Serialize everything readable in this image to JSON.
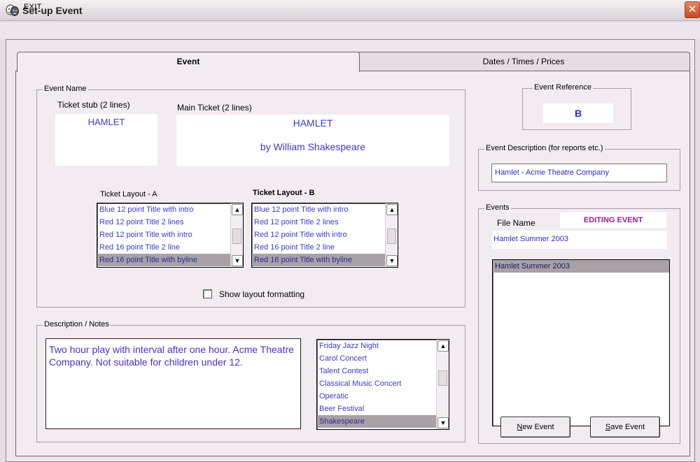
{
  "window": {
    "title": "Set-up Event",
    "close_symbol": "✕"
  },
  "menu": {
    "exit_label": "EXIT"
  },
  "tabs": [
    {
      "label": "Event",
      "active": true
    },
    {
      "label": "Dates / Times / Prices",
      "active": false
    }
  ],
  "event_name": {
    "group_label": "Event Name",
    "ticket_stub_label": "Ticket stub (2 lines)",
    "ticket_stub_text": "HAMLET",
    "main_ticket_label": "Main Ticket (2 lines)",
    "main_ticket_line1": "HAMLET",
    "main_ticket_line2": "by William Shakespeare",
    "layout_a_label": "Ticket Layout -  A",
    "layout_b_label": "Ticket Layout -  B",
    "layout_options": [
      "Blue 12 point Title with intro",
      "Red 12 point Title 2 lines",
      "Red 12 point Title with intro",
      "Red 16 point Title 2 line",
      "Red 16 point Title with byline"
    ],
    "layout_a_selected_index": 4,
    "layout_b_selected_index": 4,
    "show_layout_label": "Show layout formatting",
    "show_layout_checked": false
  },
  "description": {
    "group_label": "Description / Notes",
    "notes_text": "Two hour play with interval after one hour. Acme Theatre Company. Not suitable for children under 12.",
    "genres": [
      "Friday Jazz Night",
      "Carol Concert",
      "Talent Contest",
      "Classical Music Concert",
      "Operatic",
      "Beer Festival",
      "Shakespeare"
    ],
    "genre_selected_index": 6
  },
  "event_reference": {
    "group_label": "Event Reference",
    "value": "B"
  },
  "event_description": {
    "group_label": "Event Description (for reports etc.)",
    "value": "Hamlet - Acme Theatre Company"
  },
  "events": {
    "group_label": "Events",
    "file_name_label": "File Name",
    "editing_badge": "EDITING EVENT",
    "file_name_value": "Hamlet Summer 2003",
    "list": [
      "Hamlet Summer 2003"
    ],
    "selected_index": 0,
    "new_event_accel": "N",
    "new_event_rest": "ew Event",
    "save_event_accel": "S",
    "save_event_rest": "ave Event"
  },
  "colors": {
    "ticket_text": "#3a3ad6",
    "notes_text": "#4b2fd0",
    "editing_badge": "#9a1c8c",
    "close_button": "#d65a35"
  },
  "icons": {
    "app": "theatre-masks-icon",
    "close": "close-icon",
    "scroll_up": "arrow-up-icon",
    "scroll_down": "arrow-down-icon"
  }
}
